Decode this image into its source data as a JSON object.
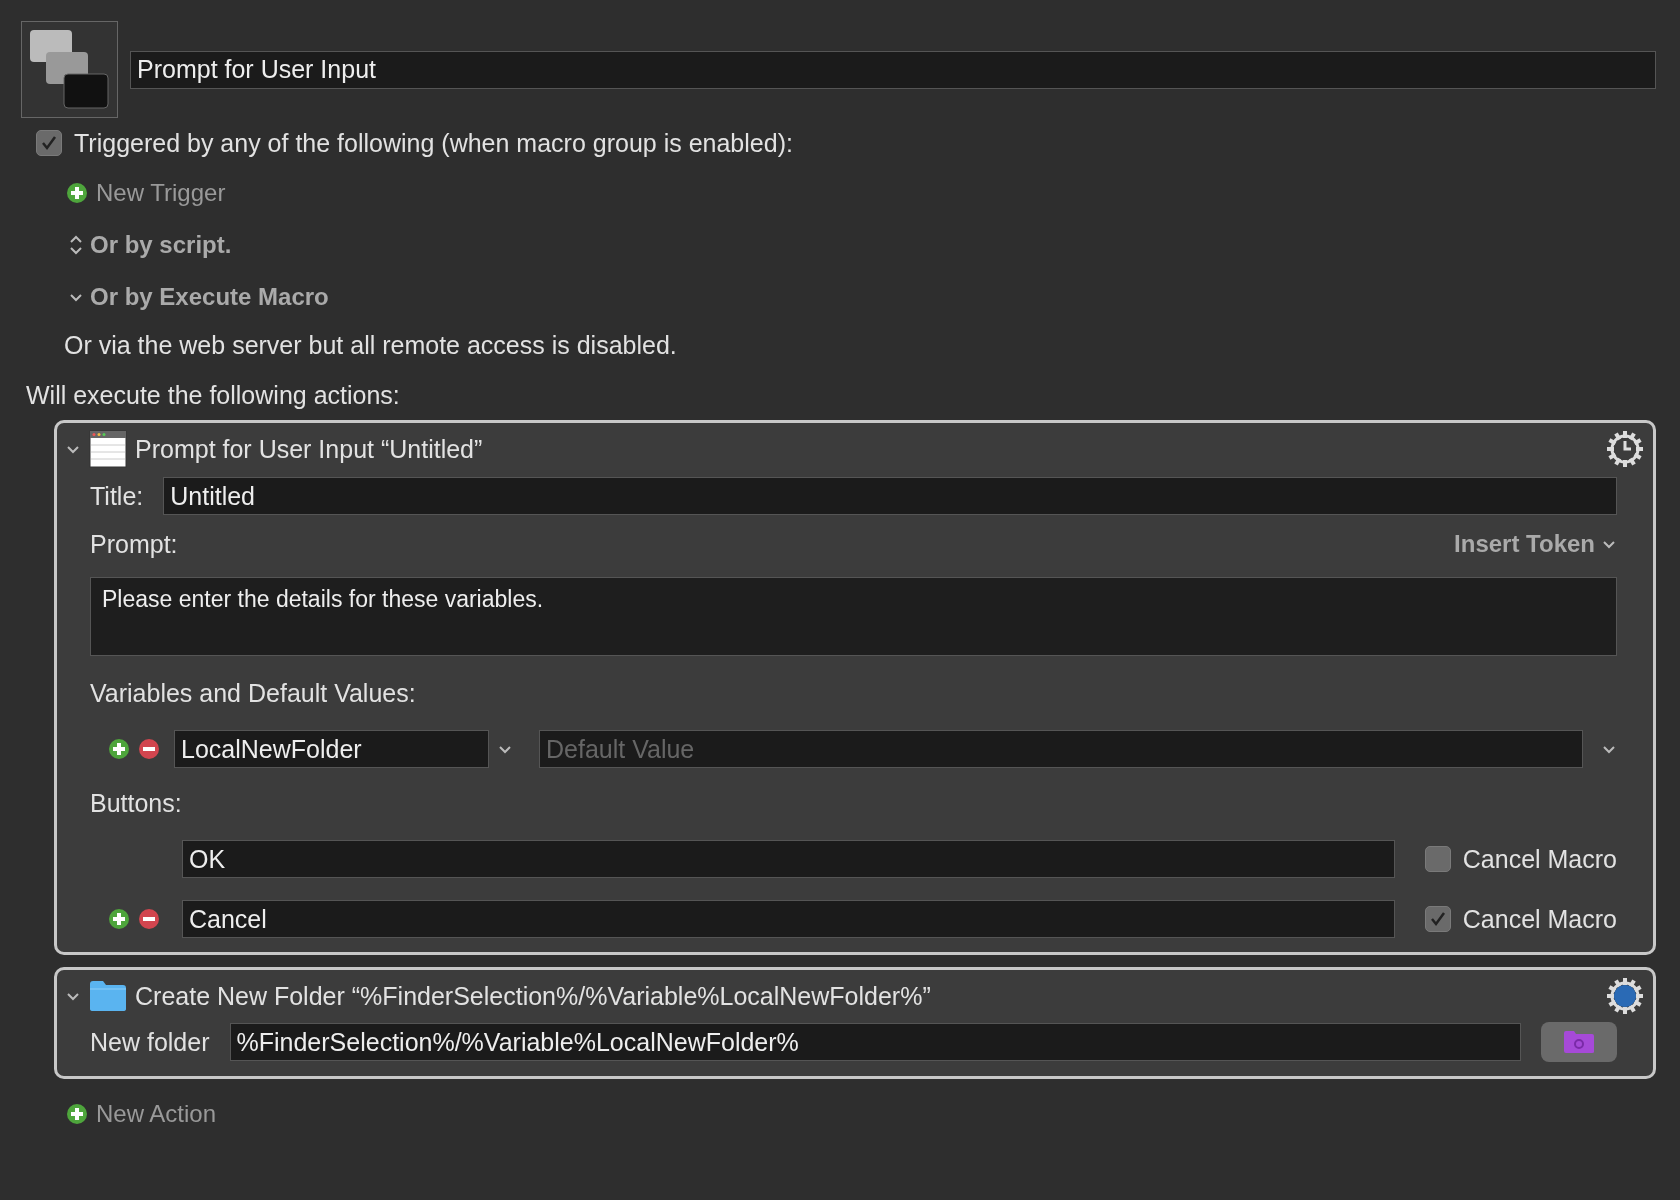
{
  "macro": {
    "name": "Prompt for User Input"
  },
  "trigger": {
    "checked": true,
    "label": "Triggered by any of the following (when macro group is enabled):"
  },
  "new_trigger": "New Trigger",
  "disclosures": [
    {
      "label": "Or by script.",
      "expanded": false
    },
    {
      "label": "Or by Execute Macro",
      "expanded": true
    }
  ],
  "web_server_note": "Or via the web server but all remote access is disabled.",
  "actions_heading": "Will execute the following actions:",
  "actions": [
    {
      "kind": "prompt",
      "expanded": true,
      "title": "Prompt for User Input “Untitled”",
      "title_label": "Title:",
      "title_value": "Untitled",
      "prompt_label": "Prompt:",
      "insert_token": "Insert Token",
      "prompt_value": "Please enter the details for these variables.",
      "variables_label": "Variables and Default Values:",
      "variables": [
        {
          "name": "LocalNewFolder",
          "placeholder": "Default Value"
        }
      ],
      "buttons_label": "Buttons:",
      "buttons": [
        {
          "value": "OK",
          "cancel_label": "Cancel Macro",
          "checked": false
        },
        {
          "value": "Cancel",
          "cancel_label": "Cancel Macro",
          "checked": true
        }
      ]
    },
    {
      "kind": "folder",
      "expanded": true,
      "title": "Create New Folder “%FinderSelection%/%Variable%LocalNewFolder%”",
      "field_label": "New folder",
      "field_value": "%FinderSelection%/%Variable%LocalNewFolder%"
    }
  ],
  "new_action": "New Action"
}
